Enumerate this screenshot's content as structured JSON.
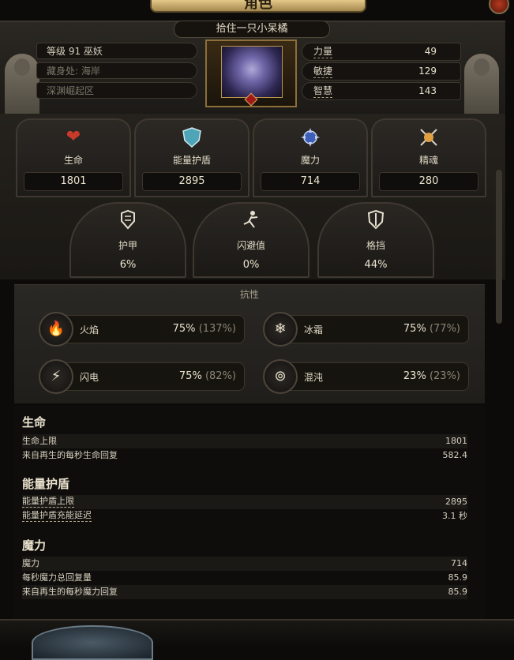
{
  "window": {
    "title": "角色"
  },
  "header": {
    "character_name": "拾住一只小呆橘",
    "level_class": "等级 91 巫妖",
    "hideout_label": "藏身处: 海岸",
    "location": "深渊崛起区"
  },
  "attributes": [
    {
      "name": "力量",
      "value": "49"
    },
    {
      "name": "敏捷",
      "value": "129"
    },
    {
      "name": "智慧",
      "value": "143"
    }
  ],
  "core_stats": [
    {
      "label": "生命",
      "value": "1801",
      "icon": "heart-icon"
    },
    {
      "label": "能量护盾",
      "value": "2895",
      "icon": "energy-shield-icon"
    },
    {
      "label": "魔力",
      "value": "714",
      "icon": "mana-icon"
    },
    {
      "label": "精魂",
      "value": "280",
      "icon": "spirit-icon"
    }
  ],
  "defense_stats": [
    {
      "label": "护甲",
      "value": "6%",
      "icon": "armour-icon"
    },
    {
      "label": "闪避值",
      "value": "0%",
      "icon": "evasion-icon"
    },
    {
      "label": "格挡",
      "value": "44%",
      "icon": "block-shield-icon"
    }
  ],
  "resistances": {
    "title": "抗性",
    "items": [
      {
        "name": "火焰",
        "value": "75%",
        "cap": "(137%)",
        "icon": "fire-icon"
      },
      {
        "name": "冰霜",
        "value": "75%",
        "cap": "(77%)",
        "icon": "cold-icon"
      },
      {
        "name": "闪电",
        "value": "75%",
        "cap": "(82%)",
        "icon": "lightning-icon"
      },
      {
        "name": "混沌",
        "value": "23%",
        "cap": "(23%)",
        "icon": "chaos-icon"
      }
    ]
  },
  "sections": [
    {
      "title": "生命",
      "rows": [
        {
          "label": "生命上限",
          "value": "1801"
        },
        {
          "label": "来自再生的每秒生命回复",
          "value": "582.4"
        }
      ]
    },
    {
      "title": "能量护盾",
      "rows": [
        {
          "label": "能量护盾上限",
          "value": "2895"
        },
        {
          "label": "能量护盾充能延迟",
          "value": "3.1 秒"
        }
      ]
    },
    {
      "title": "魔力",
      "rows": [
        {
          "label": "魔力",
          "value": "714"
        },
        {
          "label": "每秒魔力总回复量",
          "value": "85.9"
        },
        {
          "label": "来自再生的每秒魔力回复",
          "value": "85.9"
        }
      ]
    }
  ]
}
